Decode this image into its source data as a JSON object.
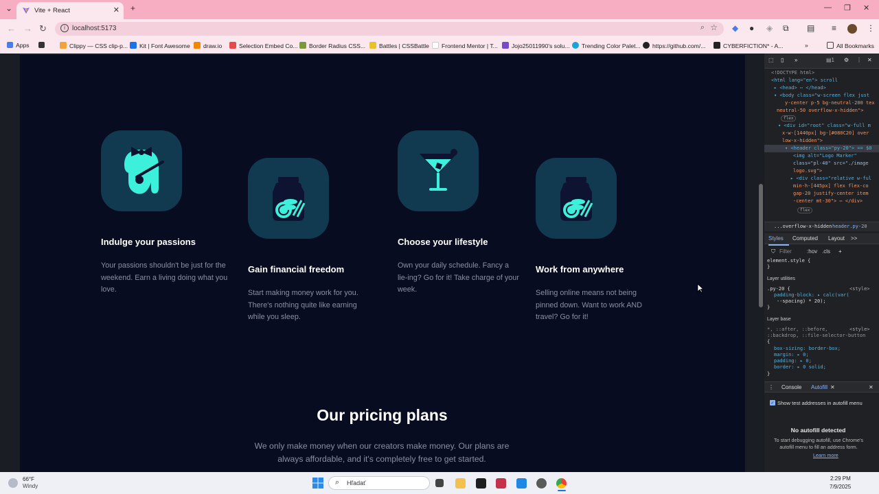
{
  "browser": {
    "tab_title": "Vite + React",
    "url": "localhost:5173",
    "bookmarks": [
      {
        "label": "Apps"
      },
      {
        "label": "Clippy — CSS clip-p..."
      },
      {
        "label": "Kit | Font Awesome"
      },
      {
        "label": "draw.io"
      },
      {
        "label": "Selection Embed Co..."
      },
      {
        "label": "Border Radius CSS..."
      },
      {
        "label": "Battles | CSSBattle"
      },
      {
        "label": "Frontend Mentor | T..."
      },
      {
        "label": "Jojo25011990's solu..."
      },
      {
        "label": "Trending Color Palet..."
      },
      {
        "label": "https://github.com/..."
      },
      {
        "label": "CYBERFICTION* - A..."
      },
      {
        "label": "All Bookmarks"
      }
    ],
    "colors": {
      "tab_strip": "#f7aec3",
      "toolbar": "#fbe7ee"
    }
  },
  "features": [
    {
      "title": "Indulge your passions",
      "description": "Your passions shouldn't be just for the weekend. Earn a living doing what you love.",
      "icon": "painting-icon"
    },
    {
      "title": "Gain financial freedom",
      "description": "Start making money work for you. There's nothing quite like earning while you sleep.",
      "icon": "coin-jar-icon"
    },
    {
      "title": "Choose your lifestyle",
      "description": "Own your daily schedule. Fancy a lie-ing? Go for it! Take charge of your week.",
      "icon": "cocktail-icon"
    },
    {
      "title": "Work from anywhere",
      "description": "Selling online means not being pinned down. Want to work AND travel? Go for it!",
      "icon": "coin-jar-icon"
    }
  ],
  "pricing": {
    "title": "Our pricing plans",
    "subtitle": "We only make money when our creators make money. Our plans are always affordable, and it's completely free to get started."
  },
  "devtools": {
    "dom_lines": [
      "<!DOCTYPE html>",
      "<html lang=\"en\"> scroll",
      "▸ <head> ⋯ </head>",
      "▾ <body class=\"w-screen flex just",
      "y-center p-5 bg-neutral-200 tex",
      "neutral-50 overflow-x-hidden\">",
      "flex",
      "▾ <div id=\"root\" class=\"w-full m",
      "x-w-[1440px] bg-[#080C20] over",
      "low-x-hidden\">",
      "▾ <header class=\"py-20\"> == $0",
      "<img alt=\"Logo Marker\"",
      "class=\"pl-40\" src=\"./image",
      "logo.svg\">",
      "▸ <div class=\"relative w-ful",
      "min-h-[445px] flex flex-co",
      "gap-20 justify-center item",
      "-center mt-30\"> ⋯ </div>",
      "flex"
    ],
    "breadcrumb": [
      "...overflow-x-hidden",
      "header.py-20"
    ],
    "panel_tabs": [
      "Styles",
      "Computed",
      "Layout",
      ">>"
    ],
    "filter_label": "Filter",
    "filter_opts": [
      ":hov",
      ".cls"
    ],
    "style_lines": [
      "element.style {",
      "}",
      "Layer utilities",
      ".py-20 {",
      "<style>",
      "padding-block: ▸ calc(var(",
      "--spacing) * 20);",
      "}",
      "Layer base",
      "*, ::after, ::before,",
      "<style>",
      "::backdrop, ::file-selector-button",
      "{",
      "box-sizing: border-box;",
      "margin: ▸ 0;",
      "padding: ▸ 0;",
      "border: ▸ 0 solid;",
      "}"
    ],
    "drawer_tabs": [
      "Console",
      "Autofill"
    ],
    "autofill_checkbox": "Show test addresses in autofill menu",
    "autofill_title": "No autofill detected",
    "autofill_text": "To start debugging autofill, use Chrome's autofill menu to fill an address form.",
    "learn_more": "Learn more"
  },
  "taskbar": {
    "temperature": "66°F",
    "weather": "Windy",
    "search_placeholder": "Hľadať",
    "time": "2:29 PM",
    "date": "7/9/2025"
  }
}
